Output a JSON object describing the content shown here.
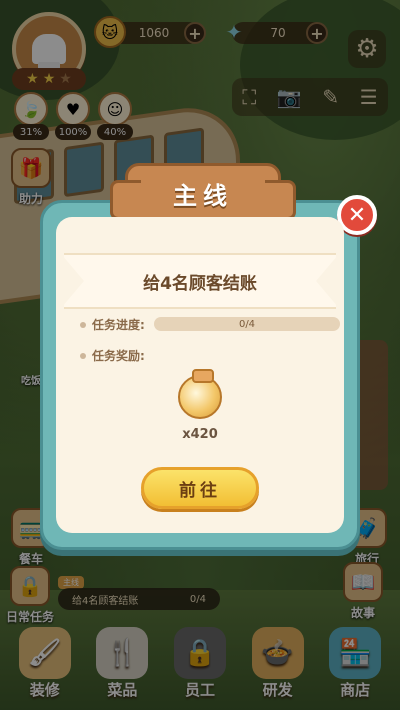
{
  "hud": {
    "coins": "1060",
    "gems": "70",
    "stats": [
      "31%",
      "100%",
      "40%"
    ],
    "stars": {
      "filled": 2,
      "total": 3
    }
  },
  "side": {
    "assist": "助力",
    "chat": "吃饭",
    "dining_car": "餐车",
    "travel": "旅行",
    "daily_tasks": "日常任务",
    "story": "故事"
  },
  "quest_strip": {
    "tag": "主线",
    "text": "给4名顾客结账",
    "progress": "0/4"
  },
  "nav": [
    "装修",
    "菜品",
    "员工",
    "研发",
    "商店"
  ],
  "modal": {
    "title": "主线",
    "task": "给4名顾客结账",
    "progress_label": "任务进度:",
    "progress_value": "0/4",
    "progress_fraction": 0.0,
    "reward_label": "任务奖励:",
    "reward_amount": "x420",
    "go_button": "前往"
  },
  "colors": {
    "modal_border": "#6fb7b6",
    "title_plaque": "#c78751",
    "close": "#e24a3b",
    "go_button": "#f2bf34"
  }
}
